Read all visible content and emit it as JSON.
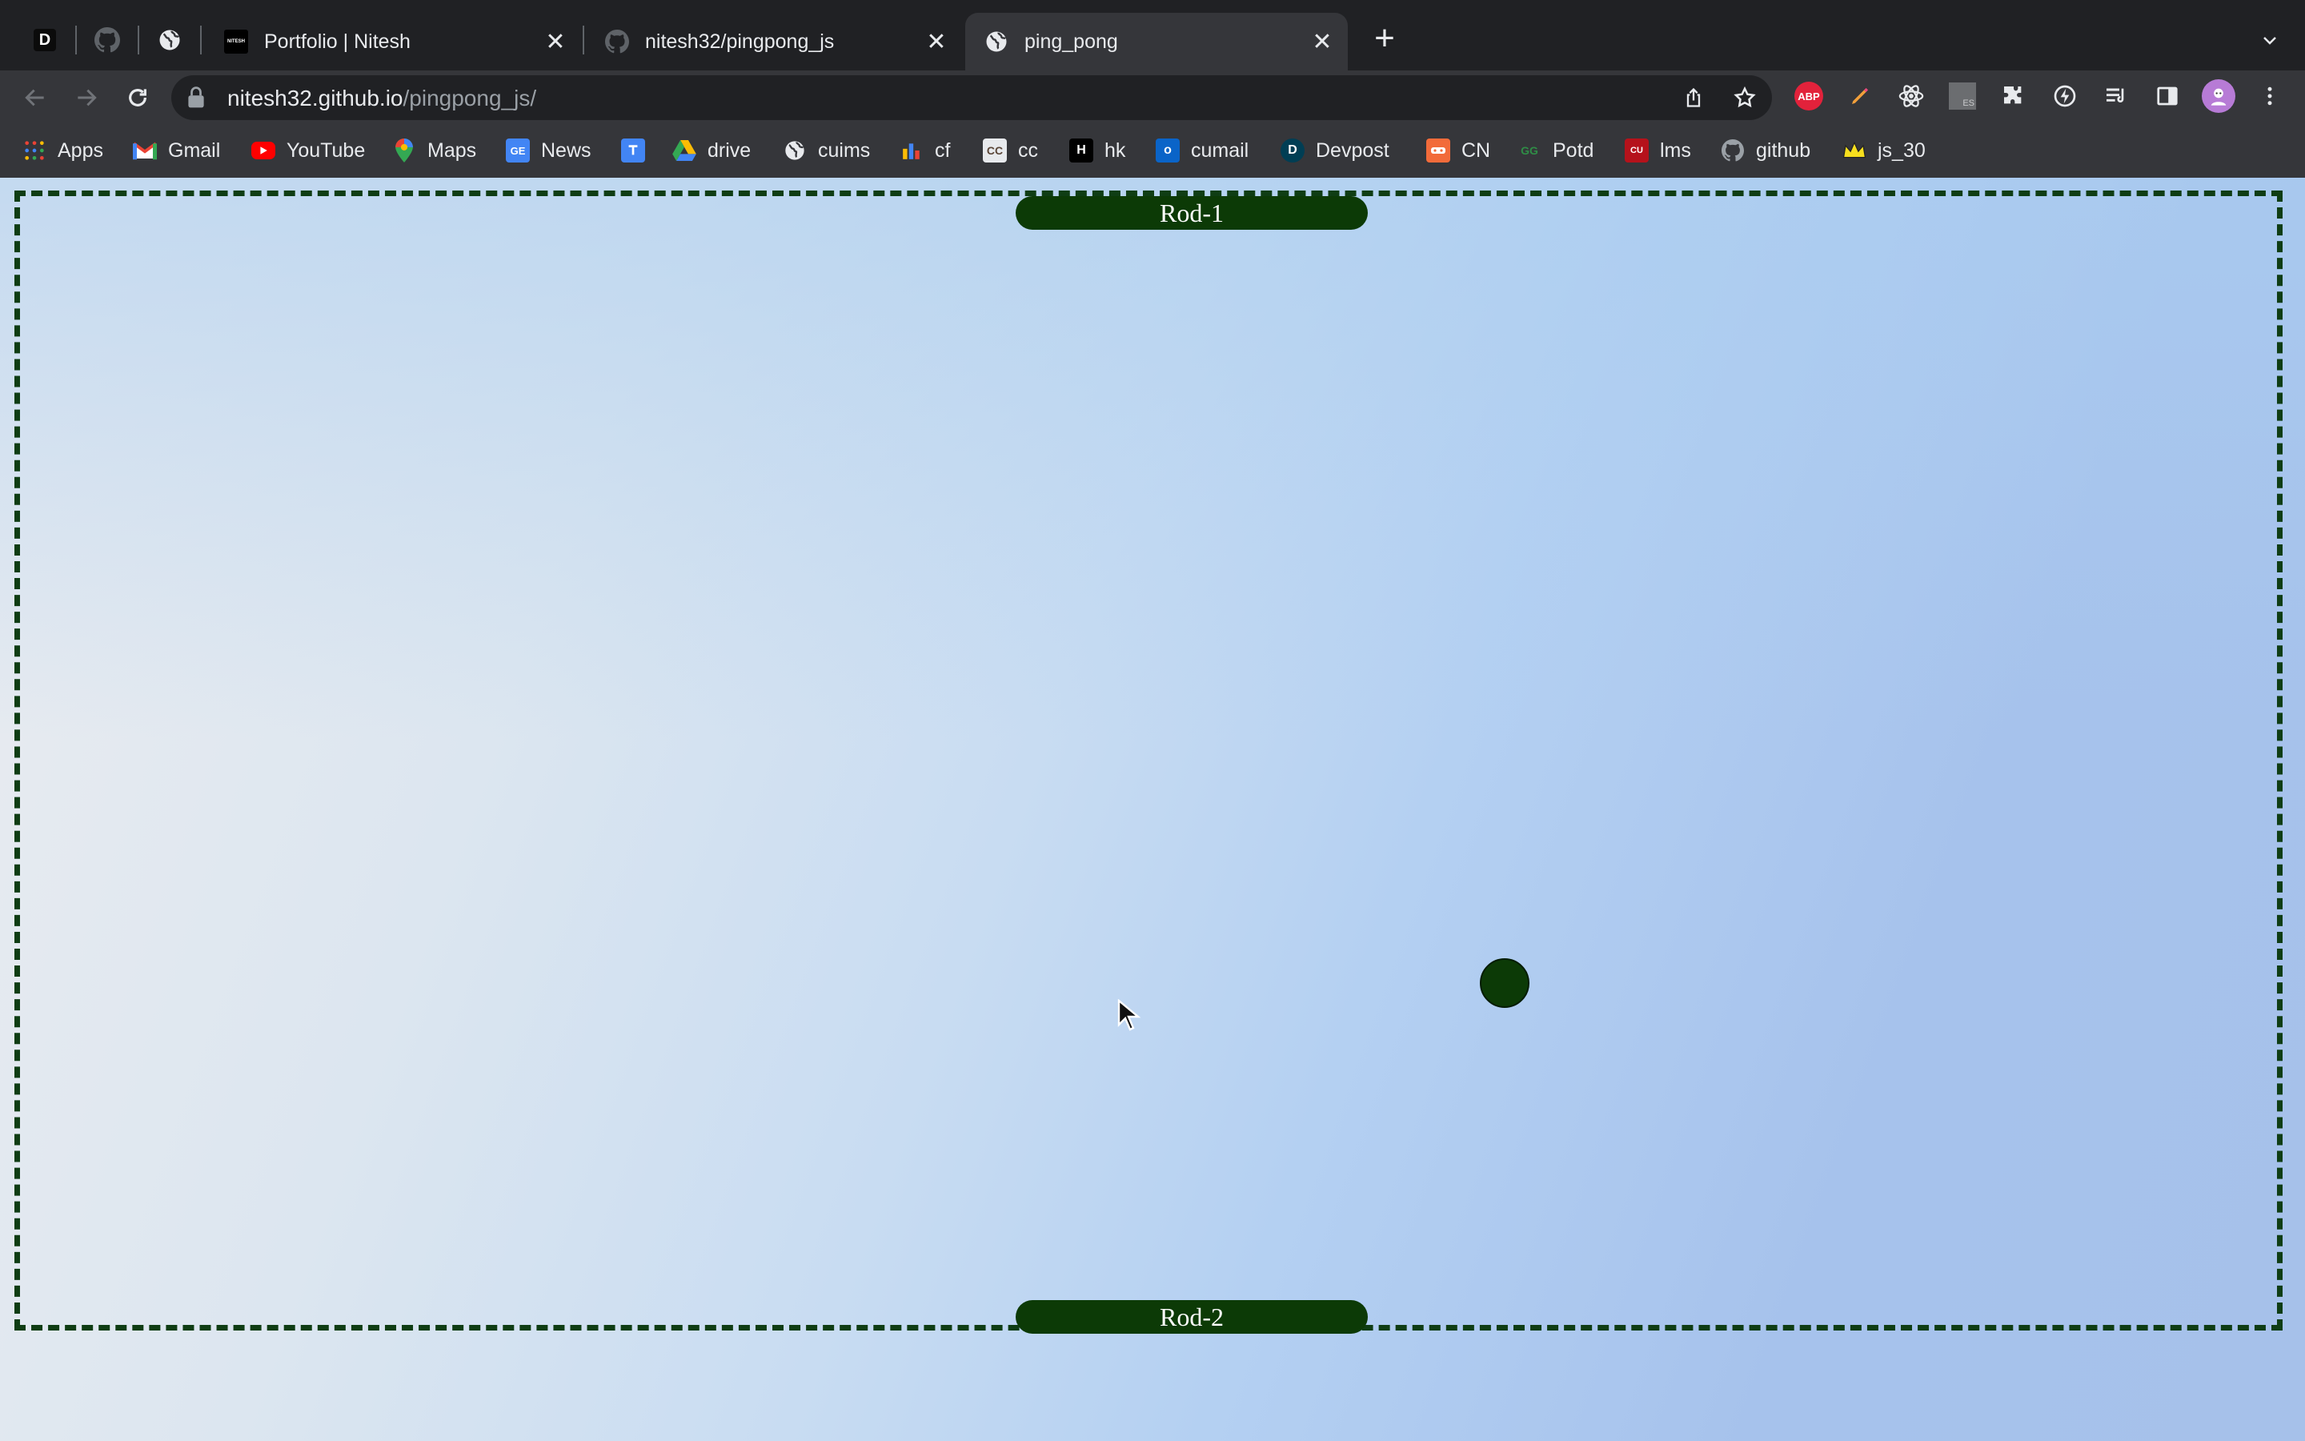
{
  "browser": {
    "pinned_tabs": [
      {
        "icon": "dev-to-icon",
        "letter": "D"
      },
      {
        "icon": "github-icon"
      },
      {
        "icon": "globe-icon"
      }
    ],
    "tabs": [
      {
        "title": "Portfolio | Nitesh",
        "icon": "nitesh-portfolio-icon",
        "favicon_text": "NITESH",
        "active": false
      },
      {
        "title": "nitesh32/pingpong_js",
        "icon": "github-icon",
        "active": false
      },
      {
        "title": "ping_pong",
        "icon": "globe-icon",
        "active": true
      }
    ],
    "close_glyph": "✕",
    "new_tab_glyph": "+",
    "address": {
      "host": "nitesh32.github.io",
      "path": "/pingpong_js/"
    },
    "extension_labels": {
      "adblock": "ABP",
      "es": "ES"
    },
    "bookmarks": [
      {
        "label": "Apps",
        "icon": "apps-grid-icon"
      },
      {
        "label": "Gmail",
        "icon": "gmail-icon"
      },
      {
        "label": "YouTube",
        "icon": "youtube-icon"
      },
      {
        "label": "Maps",
        "icon": "maps-icon"
      },
      {
        "label": "News",
        "icon": "news-icon",
        "badge": "GE"
      },
      {
        "label": "",
        "icon": "google-translate-icon"
      },
      {
        "label": "drive",
        "icon": "drive-icon"
      },
      {
        "label": "cuims",
        "icon": "globe-icon"
      },
      {
        "label": "cf",
        "icon": "codeforces-icon"
      },
      {
        "label": "cc",
        "icon": "codechef-icon",
        "badge": "CC"
      },
      {
        "label": "hk",
        "icon": "hackerrank-icon",
        "badge": "H"
      },
      {
        "label": "cumail",
        "icon": "outlook-icon",
        "badge": "o"
      },
      {
        "label": "Devpost",
        "icon": "devpost-icon",
        "badge": "D"
      },
      {
        "label": "CN",
        "icon": "coding-ninjas-icon"
      },
      {
        "label": "Potd",
        "icon": "gfg-icon",
        "badge": "GG"
      },
      {
        "label": "lms",
        "icon": "lms-icon",
        "badge": "CU"
      },
      {
        "label": "github",
        "icon": "github-icon"
      },
      {
        "label": "js_30",
        "icon": "js30-crown-icon"
      }
    ]
  },
  "game": {
    "rod_top_label": "Rod-1",
    "rod_bottom_label": "Rod-2",
    "ball_color": "#0c3a06",
    "border_color": "#0f3d14"
  }
}
